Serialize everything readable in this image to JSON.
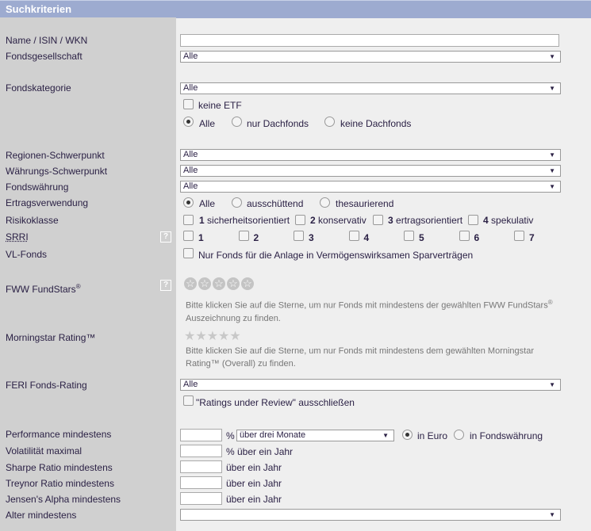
{
  "header": {
    "title": "Suchkriterien"
  },
  "labels": {
    "name": "Name / ISIN / WKN",
    "gesellschaft": "Fondsgesellschaft",
    "kategorie": "Fondskategorie",
    "regionen": "Regionen-Schwerpunkt",
    "waehrungs": "Währungs-Schwerpunkt",
    "fondswaehrung": "Fondswährung",
    "ertrag": "Ertragsverwendung",
    "risiko": "Risikoklasse",
    "srri": "SRRI",
    "vl": "VL-Fonds",
    "fundstars": "FWW FundStars",
    "morningstar": "Morningstar Rating™",
    "feri": "FERI Fonds-Rating",
    "performance": "Performance mindestens",
    "volatilitaet": "Volatilität maximal",
    "sharpe": "Sharpe Ratio mindestens",
    "treynor": "Treynor Ratio mindestens",
    "jensen": "Jensen's Alpha mindestens",
    "alter": "Alter mindestens"
  },
  "fields": {
    "name_value": "",
    "gesellschaft": "Alle",
    "kategorie": "Alle",
    "regionen": "Alle",
    "waehrungs": "Alle",
    "fondswaehrung": "Alle",
    "feri": "Alle",
    "alter": "",
    "performance_period": "über drei Monate"
  },
  "options": {
    "keine_etf": "keine ETF",
    "dach": [
      "Alle",
      "nur Dachfonds",
      "keine Dachfonds"
    ],
    "ertrag": [
      "Alle",
      "ausschüttend",
      "thesaurierend"
    ],
    "risiko": [
      {
        "n": "1",
        "t": "sicherheitsorientiert"
      },
      {
        "n": "2",
        "t": "konservativ"
      },
      {
        "n": "3",
        "t": "ertragsorientiert"
      },
      {
        "n": "4",
        "t": "spekulativ"
      }
    ],
    "srri": [
      "1",
      "2",
      "3",
      "4",
      "5",
      "6",
      "7"
    ],
    "vl": "Nur Fonds für die Anlage in Vermögenswirksamen Sparverträgen",
    "ratings_review": "\"Ratings under Review\" ausschließen",
    "waehrung": [
      "in Euro",
      "in Fondswährung"
    ]
  },
  "hints": {
    "fundstars_1": "Bitte klicken Sie auf die Sterne, um nur Fonds mit mindestens der gewählten FWW FundStars",
    "fundstars_2": "Auszeichnung zu finden.",
    "morningstar_1": "Bitte klicken Sie auf die Sterne, um nur Fonds mit mindestens dem gewählten Morningstar",
    "morningstar_2": "Rating™ (Overall) zu finden."
  },
  "units": {
    "percent": "%",
    "pct_year": "% über ein Jahr",
    "year": "über ein Jahr",
    "reg": "®",
    "help": "?"
  }
}
